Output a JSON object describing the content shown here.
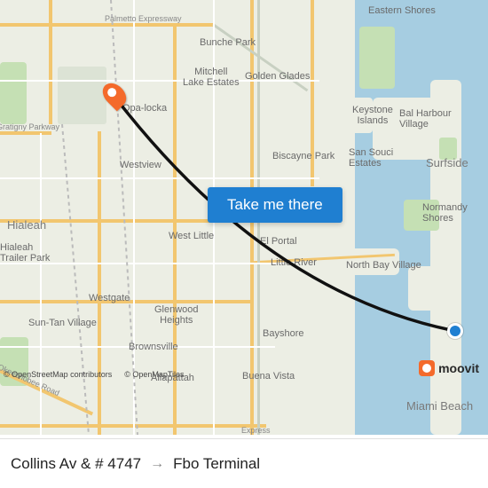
{
  "cta": {
    "label": "Take me there"
  },
  "route": {
    "origin_label": "Collins Av & # 4747",
    "destination_label": "Fbo Terminal",
    "arrow": "→",
    "origin_marker_color": "#1f7fd1",
    "dest_marker_color": "#f46a2b"
  },
  "attribution": {
    "osm": "© OpenStreetMap contributors",
    "omt": "© OpenMapTiles"
  },
  "moovit": {
    "brand": "moovit"
  },
  "map_labels": {
    "palmetto": "Palmetto Expressway",
    "bunche": "Bunche Park",
    "eastern": "Eastern Shores",
    "mitchell": "Mitchell\nLake Estates",
    "golden": "Golden Glades",
    "opalocka": "Opa-locka",
    "gratigny": "Gratigny Parkway",
    "keystone": "Keystone\nIslands",
    "balharbour": "Bal Harbour\nVillage",
    "westview": "Westview",
    "biscaynepark": "Biscayne Park",
    "sansouci": "San Souci\nEstates",
    "surfside": "Surfside",
    "hialeah": "Hialeah",
    "trailerpark": "Hialeah\nTrailer Park",
    "westlittle": "West Little",
    "elportal": "El Portal",
    "littleriver": "Little River",
    "normandy": "Normandy\nShores",
    "northbay": "North Bay Village",
    "westgate": "Westgate",
    "glenwood": "Glenwood\nHeights",
    "suntan": "Sun-Tan Village",
    "brownsville": "Brownsville",
    "bayshore": "Bayshore",
    "okeechobee": "Okeechobee Road",
    "allapattah": "Allapattah",
    "buenavista": "Buena Vista",
    "miamibeach": "Miami Beach",
    "express": "Express"
  }
}
